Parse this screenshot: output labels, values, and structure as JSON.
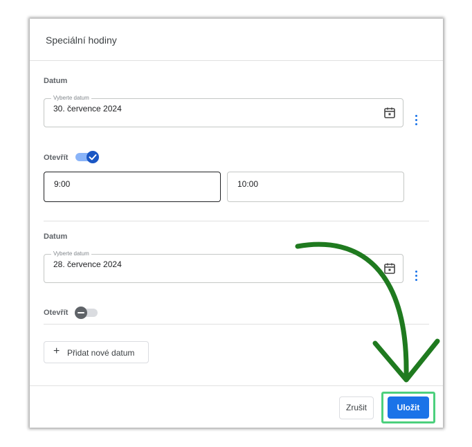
{
  "dialog": {
    "title": "Speciální hodiny",
    "entries": [
      {
        "section_label": "Datum",
        "date_label": "Vyberte datum",
        "date_value": "30. července 2024",
        "toggle_label": "Otevřít",
        "open": true,
        "time_from": "9:00",
        "time_to": "10:00"
      },
      {
        "section_label": "Datum",
        "date_label": "Vyberte datum",
        "date_value": "28. července 2024",
        "toggle_label": "Otevřít",
        "open": false
      }
    ],
    "add_date_label": "Přidat nové datum",
    "cancel_label": "Zrušit",
    "save_label": "Uložit"
  },
  "colors": {
    "accent": "#1a73e8",
    "highlight": "#4cd07d",
    "arrow": "#1f7a1f"
  },
  "icons": [
    "calendar-icon",
    "more-vert-icon",
    "check-icon",
    "minus-icon",
    "plus-icon",
    "arrow-annotation"
  ]
}
